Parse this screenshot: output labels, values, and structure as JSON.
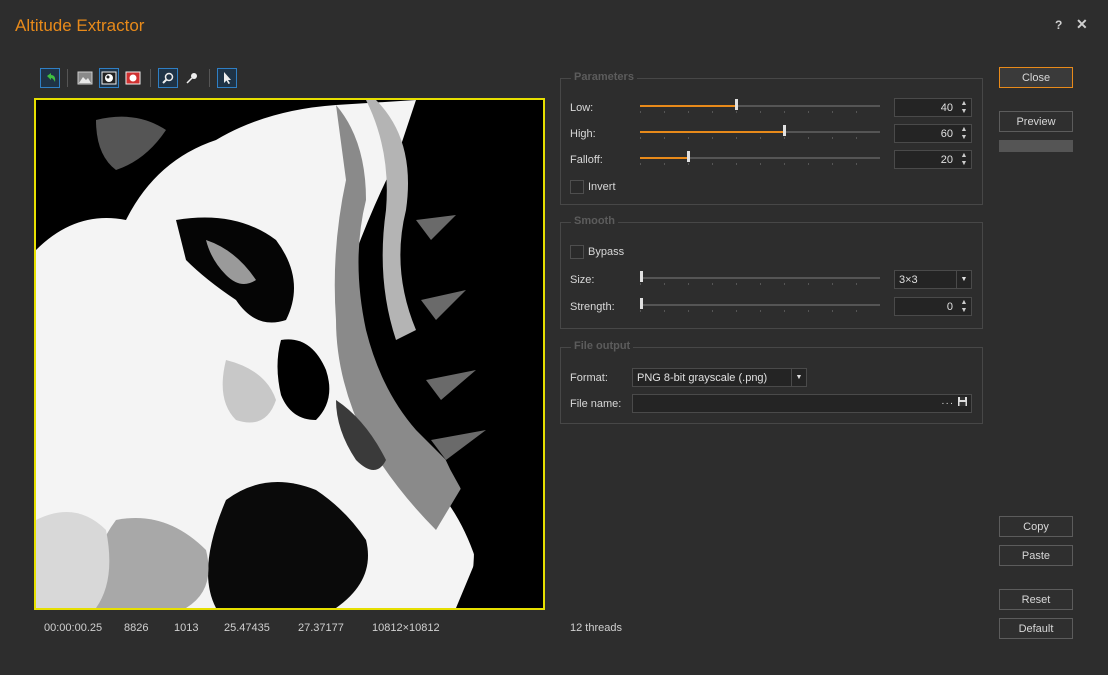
{
  "window": {
    "title": "Altitude Extractor",
    "help": "?",
    "close": "✕"
  },
  "toolbar": {
    "items": [
      "undo-icon",
      "image-icon",
      "image-mask-icon",
      "image-red-icon",
      "zoom-icon",
      "eyedropper-icon",
      "pointer-icon"
    ]
  },
  "stats": {
    "time": "00:00:00.25",
    "v1": "8826",
    "v2": "1013",
    "v3": "25.47435",
    "v4": "27.37177",
    "dims": "10812×10812"
  },
  "threads": "12 threads",
  "parameters": {
    "title": "Parameters",
    "low": {
      "label": "Low:",
      "value": "40",
      "fraction": 0.4
    },
    "high": {
      "label": "High:",
      "value": "60",
      "fraction": 0.6
    },
    "falloff": {
      "label": "Falloff:",
      "value": "20",
      "fraction": 0.2
    },
    "invert_label": "Invert"
  },
  "smooth": {
    "title": "Smooth",
    "bypass_label": "Bypass",
    "size": {
      "label": "Size:",
      "value": "3×3"
    },
    "strength": {
      "label": "Strength:",
      "value": "0"
    }
  },
  "file_output": {
    "title": "File output",
    "format_label": "Format:",
    "format_value": "PNG 8-bit grayscale (.png)",
    "filename_label": "File name:",
    "filename_value": "",
    "browse": "···"
  },
  "buttons": {
    "close": "Close",
    "preview": "Preview",
    "copy": "Copy",
    "paste": "Paste",
    "reset": "Reset",
    "default": "Default"
  },
  "colors": {
    "accent": "#e88a1a",
    "frame": "#e6df00",
    "background": "#2d2d2d"
  }
}
